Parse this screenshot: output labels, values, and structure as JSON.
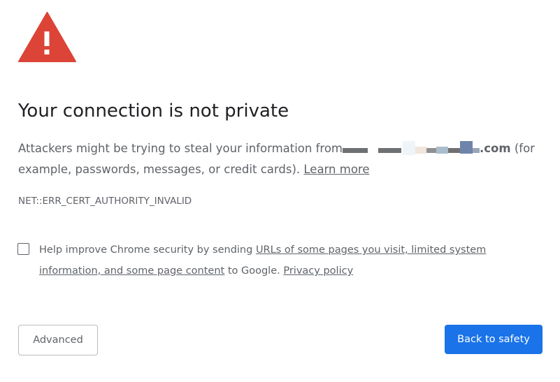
{
  "page": {
    "icon": "warning-triangle-icon",
    "title": "Your connection is not private",
    "explanation_prefix": "Attackers might be trying to steal your information from",
    "domain_suffix": ".com",
    "explanation_suffix": "(for example, passwords, messages, or credit cards).",
    "learn_more": "Learn more",
    "error_code": "NET::ERR_CERT_AUTHORITY_INVALID"
  },
  "optin": {
    "checked": false,
    "text_prefix": "Help improve Chrome security by sending",
    "link_text": "URLs of some pages you visit, limited system information, and some page content",
    "text_middle": "to Google.",
    "privacy_link": "Privacy policy"
  },
  "buttons": {
    "advanced_label": "Advanced",
    "back_label": "Back to safety"
  },
  "colors": {
    "warning_red": "#db4437",
    "primary_blue": "#1a73e8",
    "text_secondary": "#5f6368",
    "text_primary": "#202124"
  }
}
